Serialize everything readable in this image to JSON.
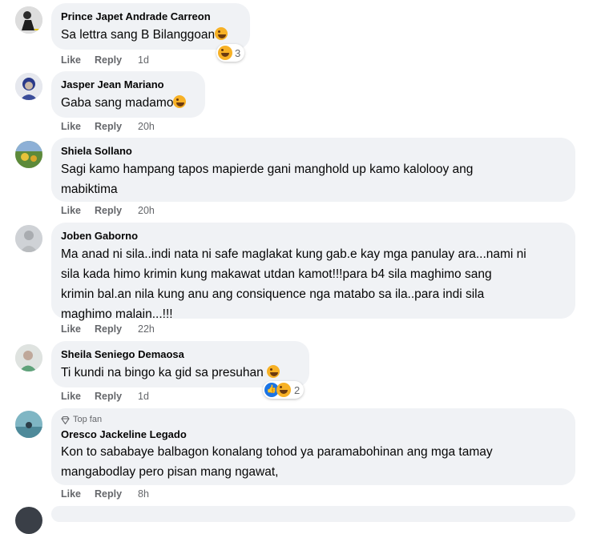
{
  "comments": [
    {
      "author": "Prince Japet Andrade Carreon",
      "text": "Sa lettra sang B Bilanggoan",
      "like": "Like",
      "reply": "Reply",
      "time": "1d",
      "reaction_count": "3"
    },
    {
      "author": "Jasper Jean Mariano",
      "text": "Gaba sang madamo",
      "like": "Like",
      "reply": "Reply",
      "time": "20h"
    },
    {
      "author": "Shiela Sollano",
      "text_lines": [
        "Sagi kamo hampang tapos mapierde gani manghold up kamo kalolooy ang",
        "mabiktima"
      ],
      "like": "Like",
      "reply": "Reply",
      "time": "20h"
    },
    {
      "author": "Joben Gaborno",
      "text_lines": [
        "Ma anad ni sila..indi nata ni safe maglakat kung gab.e kay mga panulay ara...nami ni",
        "sila kada himo krimin kung makawat utdan kamot!!!para b4 sila maghimo sang",
        "krimin bal.an nila kung anu ang consiquence nga matabo sa ila..para indi sila",
        "maghimo malain...!!!"
      ],
      "like": "Like",
      "reply": "Reply",
      "time": "22h"
    },
    {
      "author": "Sheila Seniego Demaosa",
      "text": "Ti kundi na bingo ka gid sa presuhan",
      "like": "Like",
      "reply": "Reply",
      "time": "1d",
      "reaction_count": "2"
    },
    {
      "badge": "Top fan",
      "author": "Oresco Jackeline Legado",
      "text_lines": [
        "Kon to sababaye balbagon konalang tohod ya paramabohinan ang mga tamay",
        "mangabodlay pero pisan mang ngawat,"
      ],
      "like": "Like",
      "reply": "Reply",
      "time": "8h"
    }
  ],
  "colors": {
    "bubble": "#f0f2f5",
    "meta": "#65676b",
    "haha": "#f7b125",
    "like_blue": "#1b74e4"
  },
  "icons": [
    "avatar",
    "haha-emoji-icon",
    "like-reaction-icon",
    "top-fan-diamond-icon"
  ]
}
